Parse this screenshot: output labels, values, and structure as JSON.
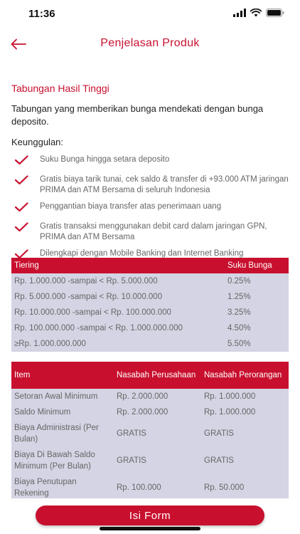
{
  "status_bar": {
    "time": "11:36"
  },
  "header": {
    "title": "Penjelasan Produk"
  },
  "product": {
    "name": "Tabungan Hasil Tinggi",
    "description": "Tabungan yang memberikan bunga mendekati dengan bunga deposito.",
    "advantages_heading": "Keunggulan:",
    "advantages": [
      "Suku Bunga hingga setara deposito",
      "Gratis biaya tarik tunai, cek saldo & transfer di +93.000 ATM jaringan PRIMA dan ATM Bersama di seluruh Indonesia",
      "Penggantian biaya transfer atas penerimaan uang",
      "Gratis transaksi menggunakan debit card dalam jaringan GPN, PRIMA dan ATM Bersama",
      "Dilengkapi dengan Mobile Banking dan Internet Banking"
    ]
  },
  "tiering_table": {
    "headers": [
      "Tiering",
      "Suku Bunga"
    ],
    "rows": [
      [
        "Rp. 1.000.000 -sampai < Rp. 5.000.000",
        "0.25%"
      ],
      [
        "Rp. 5.000.000 -sampai < Rp. 10.000.000",
        "1.25%"
      ],
      [
        "Rp. 10.000.000 -sampai < Rp. 100.000.000",
        "3.25%"
      ],
      [
        "Rp. 100.000.000 -sampai < Rp. 1.000.000.000",
        "4.50%"
      ],
      [
        "≥Rp. 1.000.000.000",
        "5.50%"
      ]
    ]
  },
  "fee_table": {
    "headers": [
      "Item",
      "Nasabah Perusahaan",
      "Nasabah Perorangan"
    ],
    "rows": [
      [
        "Setoran Awal Minimum",
        "Rp. 2.000.000",
        "Rp. 1.000.000"
      ],
      [
        "Saldo Minimum",
        "Rp. 2.000.000",
        "Rp. 1.000.000"
      ],
      [
        "Biaya Administrasi (Per Bulan)",
        "GRATIS",
        "GRATIS"
      ],
      [
        "Biaya Di Bawah Saldo Minimum (Per Bulan)",
        "GRATIS",
        "GRATIS"
      ],
      [
        "Biaya Penutupan Rekening",
        "Rp. 100.000",
        "Rp. 50.000"
      ]
    ]
  },
  "actions": {
    "submit_label": "Isi Form"
  },
  "colors": {
    "accent": "#c8102e",
    "table_row": "#d4d4e4"
  },
  "icons": {
    "back": "arrow-left-icon",
    "check": "check-icon"
  }
}
